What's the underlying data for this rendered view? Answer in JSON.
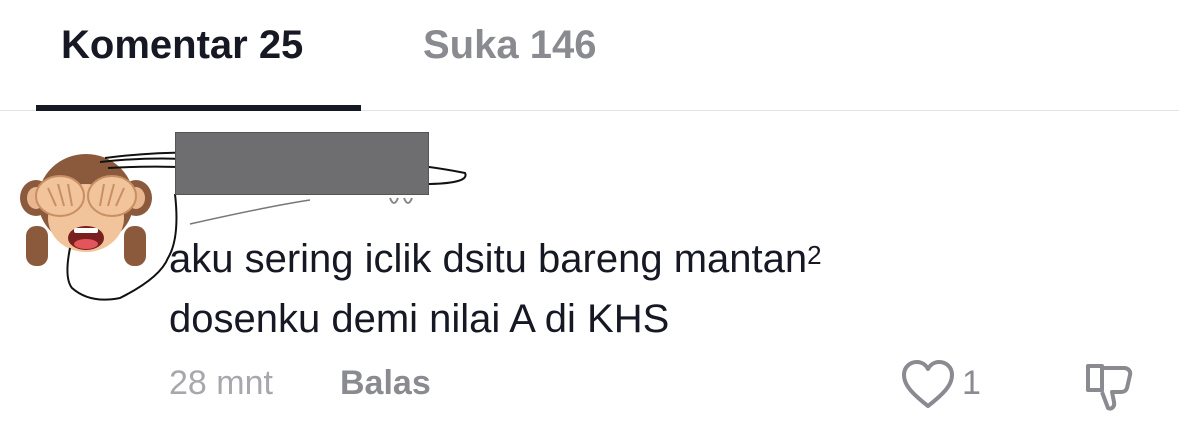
{
  "tabs": {
    "comments": "Komentar 25",
    "likes": "Suka 146"
  },
  "comment": {
    "text_main": "aku sering iclik dsitu bareng mantan",
    "text_sup": "2",
    "text_line2": "dosenku demi nilai A di KHS",
    "time": "28 mnt",
    "reply_label": "Balas",
    "like_count": "1"
  },
  "icons": {
    "avatar": "see-no-evil-monkey-emoji",
    "like": "heart-outline-icon",
    "dislike": "thumbs-down-outline-icon"
  },
  "colors": {
    "text_primary": "#161823",
    "text_secondary": "#8a8b91",
    "text_tertiary": "#a7a8ad",
    "divider": "#e3e3e4",
    "redaction": "#6e6e70"
  }
}
